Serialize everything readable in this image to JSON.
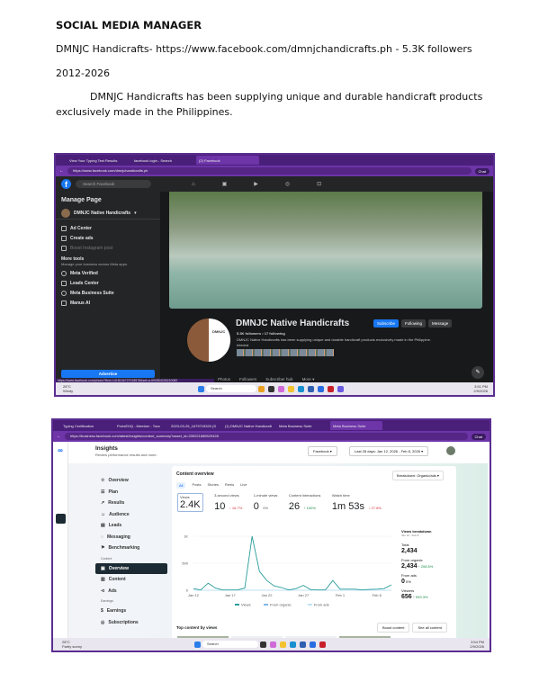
{
  "doc": {
    "title": "SOCIAL MEDIA MANAGER",
    "line1": "DMNJC Handicrafts- https://www.facebook.com/dmnjchandicrafts.ph - 5.3K followers",
    "years": "2012-2026",
    "para1": "DMNJC Handicrafts has been supplying unique and durable handicraft products",
    "para2": "exclusively made in the Philippines."
  },
  "shot1": {
    "tabs": [
      "View Your Typing Test Results",
      "facebook login - Search",
      "(2) Facebook"
    ],
    "url": "https://www.facebook.com/dmnjchandicrafts.ph",
    "chat": "Chat",
    "search_placeholder": "Search Facebook",
    "sidebar": {
      "title": "Manage Page",
      "page_name": "DMNJC Native Handicrafts",
      "items": [
        "Ad Center",
        "Create ads",
        "Boost Instagram post"
      ],
      "more_tools": "More tools",
      "more_tools_sub": "Manage your business across Meta apps.",
      "tools": [
        "Meta Verified",
        "Leads Center",
        "Meta Business Suite",
        "Manus AI"
      ],
      "advertise": "Advertise"
    },
    "profile": {
      "name": "DMNJC Native Handicrafts",
      "stats": "5.3K followers • 17 following",
      "bio": "DMNJC Native Handicrafts has been supplying unique and durable handicraft products exclusively made in the Philippine.",
      "interest": "Interest",
      "logo_text": "DMNJC",
      "subscribe": "Subscribe",
      "following": "Following",
      "message": "Message",
      "tabs": [
        "Photos",
        "Followers",
        "Subscriber hub",
        "More ▾"
      ]
    },
    "status_url": "https://www.facebook.com/photo/?fbid=1418104727018578&set=a.690854226210082",
    "taskbar": {
      "weather": "28°C",
      "weather_sub": "Windy",
      "search": "Search",
      "time": "3:51 PM",
      "date": "2/9/2026"
    }
  },
  "shot2": {
    "tabs": [
      "Typing Certification",
      "ProtxEHQ - Member - Tocc",
      "2023-03-25_1679715320 (S",
      "(1) DMNJC Native Handicraft",
      "Meta Business Suite",
      "Meta Business Suite"
    ],
    "url": "https://business.facebook.com/latest/insights/content_summary?asset_id=339221689529428",
    "chat": "Chat",
    "header": {
      "title": "Insights",
      "subtitle": "Review performance results and more.",
      "platform": "Facebook",
      "date_range": "Last 28 days: Jan 12, 2026 - Feb 8, 2026"
    },
    "nav": [
      "Overview",
      "Plan",
      "Results",
      "Audience",
      "Leads",
      "Messaging",
      "Benchmarking"
    ],
    "nav_content_label": "Content",
    "nav_content": [
      "Overview",
      "Content",
      "Ads"
    ],
    "nav_earnings_label": "Earnings",
    "nav_earnings": [
      "Earnings",
      "Subscriptions"
    ],
    "overview": {
      "title": "Content overview",
      "breakdown": "Breakdown: Organic/ads",
      "filters": [
        "All",
        "Posts",
        "Stories",
        "Reels",
        "Live"
      ],
      "kpis": [
        {
          "label": "Views",
          "value": "2.4K",
          "change": ""
        },
        {
          "label": "3-second views",
          "value": "10",
          "change": "↓ 16.7%"
        },
        {
          "label": "1-minute views",
          "value": "0",
          "change": "0%"
        },
        {
          "label": "Content interactions",
          "value": "26",
          "change": "↑ 100%"
        },
        {
          "label": "Watch time",
          "value": "1m 53s",
          "change": "↓ 27.8%"
        }
      ]
    },
    "breakdown": {
      "title": "Views breakdown",
      "range": "Jan 12 - Feb 8",
      "total_label": "Total",
      "total": "2,434",
      "organic_label": "From organic",
      "organic": "2,434",
      "organic_change": "↑ 208.5%",
      "ads_label": "From ads",
      "ads": "0",
      "ads_change": "0%",
      "viewers_label": "Viewers",
      "viewers": "656",
      "viewers_change": "↑ 993.3%"
    },
    "top": {
      "title": "Top content by views",
      "boost": "Boost content",
      "see_all": "See all content"
    },
    "taskbar": {
      "weather": "28°C",
      "weather_sub": "Partly sunny",
      "search": "Search",
      "time": "3:54 PM",
      "date": "2/9/2026"
    }
  },
  "chart_data": {
    "type": "line",
    "title": "Content overview",
    "xlabel": "",
    "ylabel": "",
    "x_ticks": [
      "Jan 12",
      "Jan 17",
      "Jan 22",
      "Jan 27",
      "Feb 1",
      "Feb 6"
    ],
    "y_ticks": [
      "0",
      "500",
      "1K"
    ],
    "ylim": [
      0,
      1000
    ],
    "x": [
      "Jan 12",
      "Jan 13",
      "Jan 14",
      "Jan 15",
      "Jan 16",
      "Jan 17",
      "Jan 18",
      "Jan 19",
      "Jan 20",
      "Jan 21",
      "Jan 22",
      "Jan 23",
      "Jan 24",
      "Jan 25",
      "Jan 26",
      "Jan 27",
      "Jan 28",
      "Jan 29",
      "Jan 30",
      "Jan 31",
      "Feb 1",
      "Feb 2",
      "Feb 3",
      "Feb 4",
      "Feb 5",
      "Feb 6",
      "Feb 7",
      "Feb 8"
    ],
    "series": [
      {
        "name": "Views",
        "color": "#2a9d9a",
        "values": [
          30,
          5,
          130,
          40,
          5,
          5,
          5,
          40,
          1000,
          350,
          180,
          80,
          50,
          5,
          30,
          90,
          10,
          5,
          5,
          180,
          20,
          20,
          20,
          5,
          15,
          20,
          30,
          100
        ]
      },
      {
        "name": "From organic",
        "color": "#7fb8e8",
        "values": []
      },
      {
        "name": "From ads",
        "color": "#bfe1f5",
        "values": []
      }
    ],
    "legend": "bottom"
  }
}
